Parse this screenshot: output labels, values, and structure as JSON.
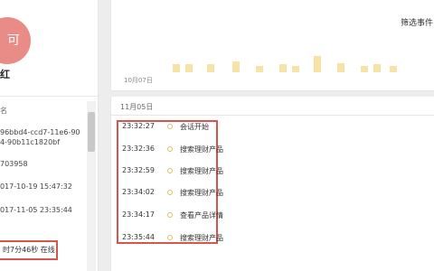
{
  "profile": {
    "avatar_char": "可",
    "name": "红",
    "info_label": "名",
    "info_lines": [
      "96bbd4-ccd7-11e6-90",
      "4-90b11c1820bf",
      "703958",
      "017-10-19 15:47:32",
      "017-11-05 23:35:44"
    ],
    "status": "时7分46秒 在线"
  },
  "top": {
    "filter_label": "筛选事件",
    "axis_date": "10月07日",
    "activity_levels": [
      0.45,
      0.45,
      0.45,
      0.6,
      0.35,
      0.45,
      0.35,
      0.9,
      0.5,
      0.35,
      0.45,
      0.35
    ]
  },
  "timeline": {
    "date": "11月05日",
    "events": [
      {
        "time": "23:32:27",
        "name": "会话开始"
      },
      {
        "time": "23:32:36",
        "name": "搜索理财产品"
      },
      {
        "time": "23:32:59",
        "name": "搜索理财产品"
      },
      {
        "time": "23:34:02",
        "name": "搜索理财产品"
      },
      {
        "time": "23:34:17",
        "name": "查看产品详情"
      },
      {
        "time": "23:35:44",
        "name": "搜索理财产品"
      }
    ]
  },
  "colors": {
    "highlight_border": "#d9534f",
    "avatar_bg": "#e98b86",
    "bar_fill": "#f7e3a6",
    "dot_border": "#e9b968"
  }
}
